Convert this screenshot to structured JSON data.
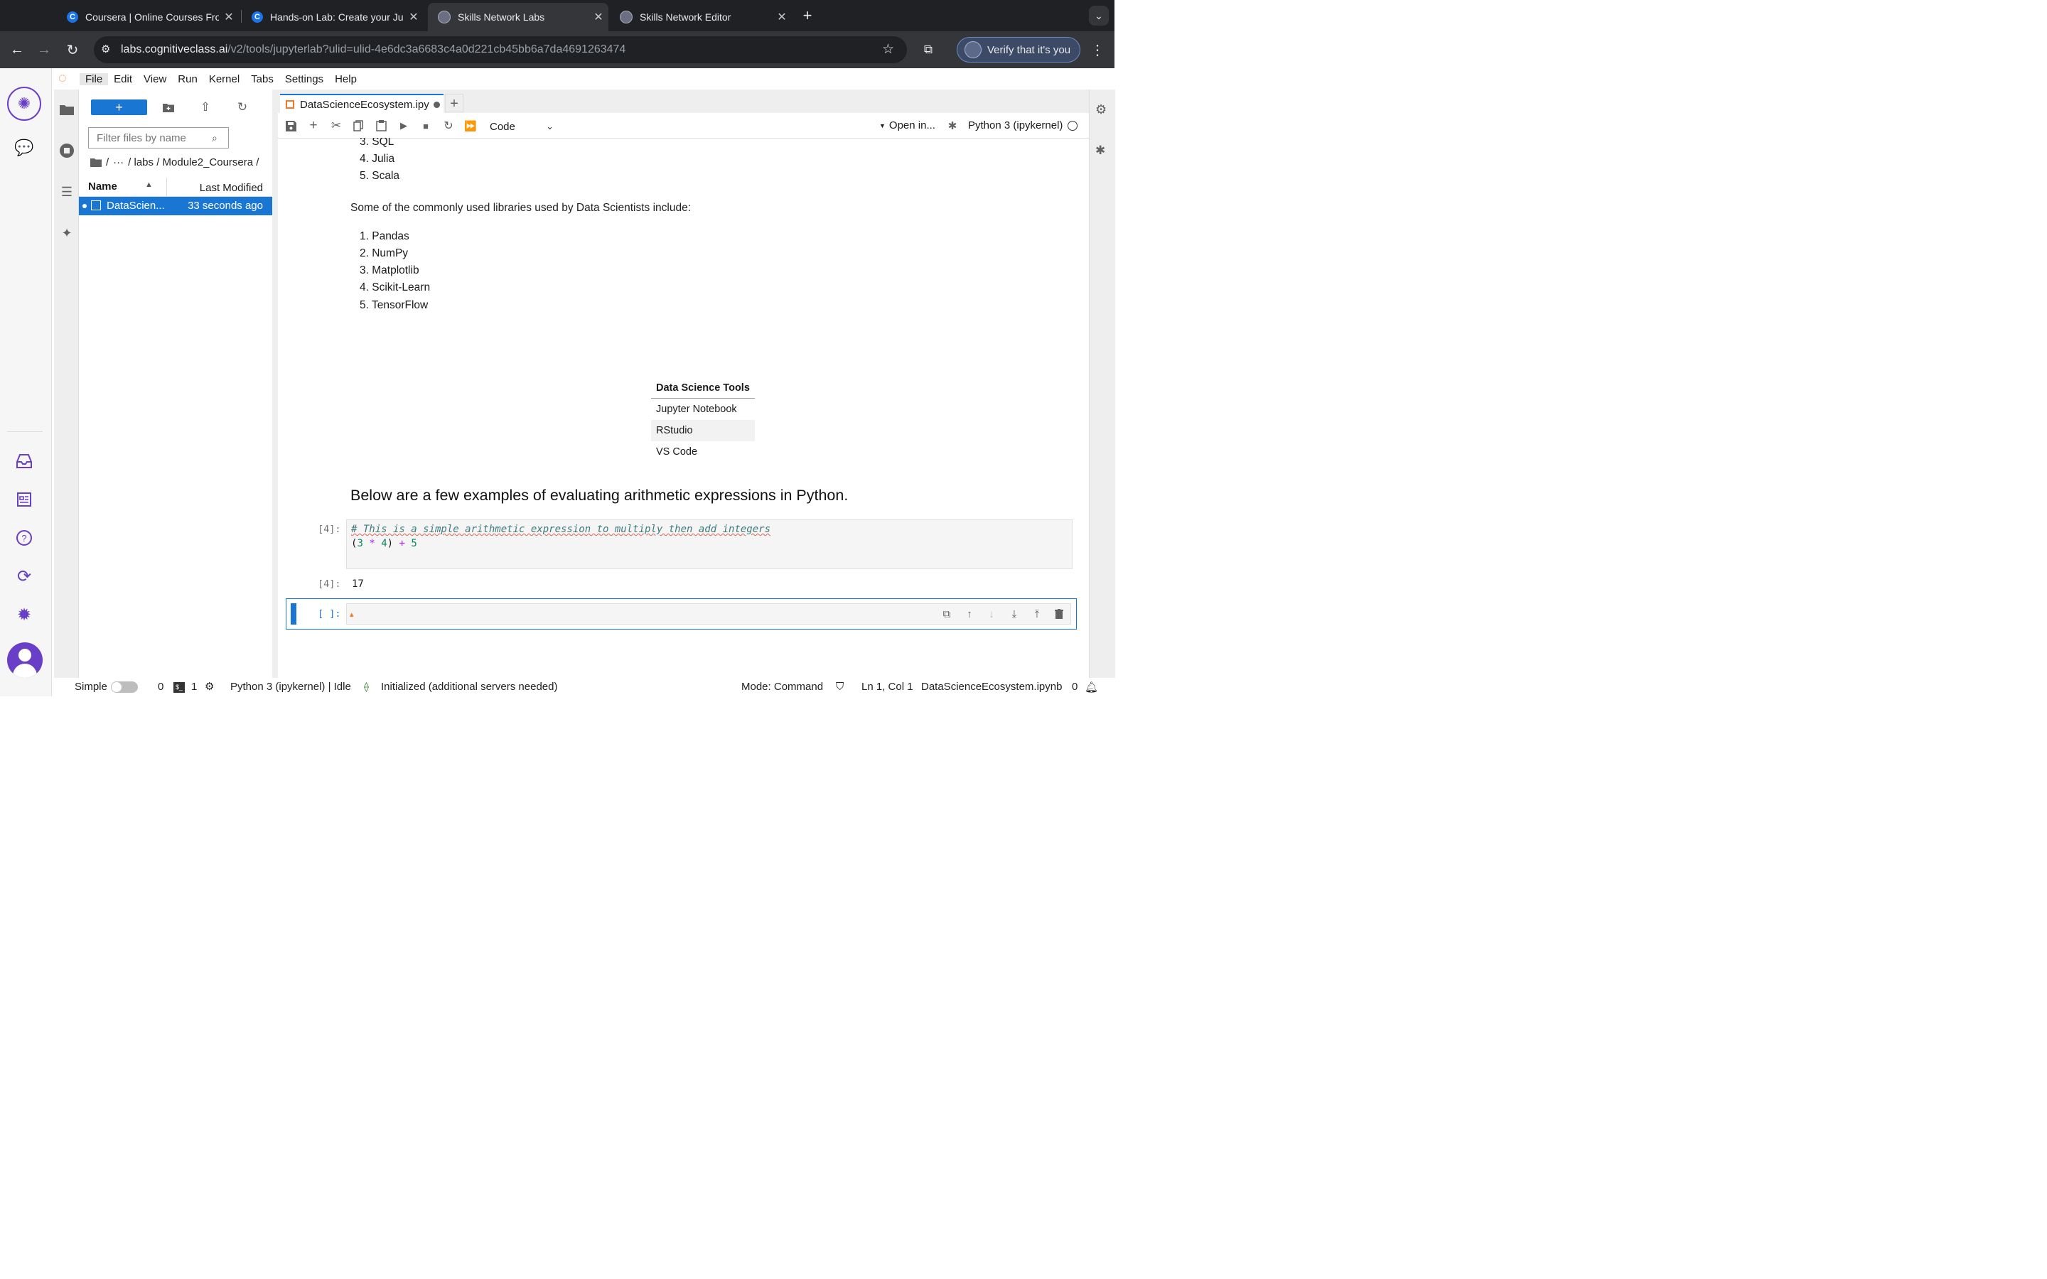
{
  "browser": {
    "tabs": [
      {
        "title": "Coursera | Online Courses Fro",
        "favicon": "C"
      },
      {
        "title": "Hands-on Lab: Create your Ju",
        "favicon": "C"
      },
      {
        "title": "Skills Network Labs",
        "favicon": ""
      },
      {
        "title": "Skills Network Editor",
        "favicon": ""
      }
    ],
    "url_host": "labs.cognitiveclass.ai",
    "url_path": "/v2/tools/jupyterlab?ulid=ulid-4e6dc3a6683c4a0d221cb45bb6a7da4691263474",
    "verify_label": "Verify that it's you"
  },
  "menu": [
    "File",
    "Edit",
    "View",
    "Run",
    "Kernel",
    "Tabs",
    "Settings",
    "Help"
  ],
  "filebrowser": {
    "new_label": "+",
    "filter_placeholder": "Filter files by name",
    "crumb_ellipsis": "···",
    "crumb_path": "/ labs / Module2_Coursera /",
    "col_name": "Name",
    "col_modified": "Last Modified",
    "file": {
      "name": "DataScien...",
      "modified": "33 seconds ago"
    }
  },
  "notebook": {
    "tab_title": "DataScienceEcosystem.ipy",
    "cell_type": "Code",
    "open_in": "Open in...",
    "kernel": "Python 3 (ipykernel)",
    "languages_tail": [
      "3. SQL",
      "4. Julia",
      "5. Scala"
    ],
    "libraries_intro": "Some of the commonly used libraries used by Data Scientists include:",
    "libraries": [
      "1. Pandas",
      "2. NumPy",
      "3. Matplotlib",
      "4. Scikit-Learn",
      "5. TensorFlow"
    ],
    "table_header": "Data Science Tools",
    "table_rows": [
      "Jupyter Notebook",
      "RStudio",
      "VS Code"
    ],
    "heading": "Below are a few examples of evaluating arithmetic expressions in Python.",
    "code_prompt": "[4]:",
    "code_comment": "# This is a simple arithmetic expression to multiply then add integers",
    "output_prompt": "[4]:",
    "output_value": "17",
    "empty_prompt": "[ ]:"
  },
  "statusbar": {
    "mode_simple": "Simple",
    "terminals": "0",
    "kernels": "1",
    "kernel_status": "Python 3 (ipykernel) | Idle",
    "lsp": "Initialized (additional servers needed)",
    "mode": "Mode: Command",
    "cursor": "Ln 1, Col 1",
    "filename": "DataScienceEcosystem.ipynb",
    "notifications": "0"
  },
  "colors": {
    "accent": "#1976d2",
    "brand_purple": "#6a3fc7",
    "chrome_dark": "#202124"
  }
}
